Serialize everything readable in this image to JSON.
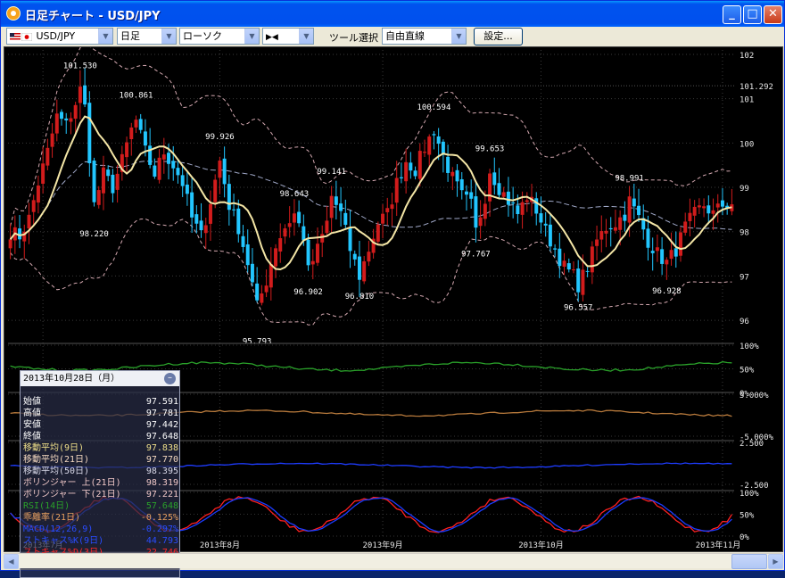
{
  "window": {
    "title": "日足チャート - USD/JPY"
  },
  "toolbar": {
    "symbol": "USD/JPY",
    "period": "日足",
    "chart_style": "ローソク",
    "marker": "▶◀",
    "tool_label": "ツール選択",
    "tool_value": "自由直線",
    "settings_label": "設定..."
  },
  "colors": {
    "up": "#d21c1c",
    "down": "#22c6ff",
    "ma9": "#f4e6a6",
    "bb": "#d4a8b0",
    "rsi": "#2aa22a",
    "deviation": "#b87a3c",
    "macd": "#1e3cff",
    "stoch_k": "#ff2020",
    "stoch_d": "#1c3cff"
  },
  "info": {
    "date": "2013年10月28日（月）",
    "rows": [
      {
        "label": "始値",
        "value": "97.591",
        "color": "#ffffff"
      },
      {
        "label": "高値",
        "value": "97.781",
        "color": "#ffffff"
      },
      {
        "label": "安値",
        "value": "97.442",
        "color": "#ffffff"
      },
      {
        "label": "終値",
        "value": "97.648",
        "color": "#ffffff"
      },
      {
        "label": "移動平均(9日)",
        "value": "97.838",
        "color": "#f0e08a"
      },
      {
        "label": "移動平均(21日)",
        "value": "97.770",
        "color": "#f4d8c0"
      },
      {
        "label": "移動平均(50日)",
        "value": "98.395",
        "color": "#d8d8e8"
      },
      {
        "label": "ボリンジャー 上(21日)",
        "value": "98.319",
        "color": "#f0c8c8"
      },
      {
        "label": "ボリンジャー 下(21日)",
        "value": "97.221",
        "color": "#f0c8c8"
      },
      {
        "label": "RSI(14日)",
        "value": "57.648",
        "color": "#2aa22a"
      },
      {
        "label": "乖離率(21日)",
        "value": "-0.125%",
        "color": "#e8a060"
      },
      {
        "label": "MACD(12,26,9)",
        "value": "-0.297%",
        "color": "#2a4cff"
      },
      {
        "label": "ストキャス%K(9日)",
        "value": "44.793",
        "color": "#2a4cff"
      },
      {
        "label": "ストキャス%D(3日)",
        "value": "22.746",
        "color": "#ff2a2a"
      },
      {
        "label": "ストキャス%SD(3日)",
        "value": "36.526",
        "color": "#2a4cff"
      }
    ]
  },
  "chart_data": {
    "type": "candlestick",
    "price_axis": {
      "ylim": [
        95.8,
        102.1
      ],
      "ticks": [
        "102",
        "101",
        "100",
        "99",
        "98",
        "97",
        "96"
      ],
      "current_label": "101.292",
      "current_value": 101.292
    },
    "x_labels": [
      "2013年7月",
      "2013年8月",
      "2013年9月",
      "2013年10月",
      "2013年11月"
    ],
    "x_label_index": [
      7,
      45,
      80,
      114,
      153
    ],
    "annotations": [
      {
        "text": "101.530",
        "index": 15,
        "value": 101.53,
        "pos": "above"
      },
      {
        "text": "100.861",
        "index": 27,
        "value": 100.861,
        "pos": "above"
      },
      {
        "text": "99.926",
        "index": 45,
        "value": 99.926,
        "pos": "above"
      },
      {
        "text": "98.220",
        "index": 18,
        "value": 98.22,
        "pos": "below"
      },
      {
        "text": "99.141",
        "index": 69,
        "value": 99.141,
        "pos": "above"
      },
      {
        "text": "98.643",
        "index": 61,
        "value": 98.643,
        "pos": "above"
      },
      {
        "text": "95.793",
        "index": 53,
        "value": 95.793,
        "pos": "below"
      },
      {
        "text": "96.902",
        "index": 64,
        "value": 96.902,
        "pos": "below"
      },
      {
        "text": "96.810",
        "index": 75,
        "value": 96.81,
        "pos": "below"
      },
      {
        "text": "100.594",
        "index": 91,
        "value": 100.594,
        "pos": "above"
      },
      {
        "text": "99.653",
        "index": 103,
        "value": 99.653,
        "pos": "above"
      },
      {
        "text": "97.767",
        "index": 100,
        "value": 97.767,
        "pos": "below"
      },
      {
        "text": "96.557",
        "index": 122,
        "value": 96.557,
        "pos": "below"
      },
      {
        "text": "98.991",
        "index": 133,
        "value": 98.991,
        "pos": "above"
      },
      {
        "text": "96.928",
        "index": 141,
        "value": 96.928,
        "pos": "below"
      }
    ],
    "anchors": [
      [
        0,
        98.0
      ],
      [
        2,
        97.9
      ],
      [
        4,
        98.3
      ],
      [
        6,
        99.1
      ],
      [
        8,
        99.8
      ],
      [
        10,
        100.6
      ],
      [
        12,
        100.4
      ],
      [
        14,
        100.9
      ],
      [
        15,
        101.2
      ],
      [
        16,
        100.8
      ],
      [
        18,
        98.6
      ],
      [
        20,
        99.3
      ],
      [
        22,
        99.0
      ],
      [
        24,
        99.6
      ],
      [
        26,
        100.3
      ],
      [
        27,
        100.5
      ],
      [
        29,
        99.8
      ],
      [
        31,
        99.3
      ],
      [
        33,
        99.8
      ],
      [
        35,
        99.5
      ],
      [
        37,
        99.1
      ],
      [
        39,
        98.3
      ],
      [
        41,
        97.9
      ],
      [
        43,
        98.7
      ],
      [
        45,
        99.6
      ],
      [
        47,
        98.6
      ],
      [
        49,
        98.1
      ],
      [
        51,
        97.3
      ],
      [
        53,
        96.3
      ],
      [
        55,
        96.9
      ],
      [
        57,
        97.7
      ],
      [
        59,
        98.1
      ],
      [
        61,
        98.4
      ],
      [
        63,
        97.9
      ],
      [
        64,
        97.1
      ],
      [
        66,
        97.6
      ],
      [
        68,
        98.2
      ],
      [
        69,
        98.8
      ],
      [
        71,
        98.4
      ],
      [
        73,
        97.6
      ],
      [
        75,
        97.0
      ],
      [
        77,
        97.6
      ],
      [
        79,
        98.2
      ],
      [
        81,
        98.4
      ],
      [
        83,
        99.1
      ],
      [
        85,
        99.6
      ],
      [
        87,
        99.4
      ],
      [
        89,
        99.9
      ],
      [
        91,
        100.3
      ],
      [
        93,
        99.7
      ],
      [
        95,
        99.2
      ],
      [
        97,
        98.8
      ],
      [
        99,
        98.6
      ],
      [
        100,
        98.0
      ],
      [
        102,
        98.8
      ],
      [
        103,
        99.4
      ],
      [
        105,
        99.0
      ],
      [
        107,
        98.7
      ],
      [
        109,
        98.4
      ],
      [
        111,
        98.8
      ],
      [
        113,
        98.5
      ],
      [
        115,
        98.0
      ],
      [
        117,
        97.6
      ],
      [
        119,
        97.2
      ],
      [
        121,
        97.0
      ],
      [
        122,
        96.8
      ],
      [
        124,
        97.2
      ],
      [
        126,
        97.8
      ],
      [
        128,
        98.1
      ],
      [
        130,
        98.2
      ],
      [
        132,
        98.4
      ],
      [
        133,
        98.7
      ],
      [
        135,
        98.3
      ],
      [
        137,
        97.8
      ],
      [
        139,
        97.5
      ],
      [
        141,
        97.3
      ],
      [
        143,
        97.6
      ],
      [
        145,
        98.1
      ],
      [
        147,
        98.4
      ],
      [
        149,
        98.6
      ],
      [
        151,
        98.4
      ],
      [
        153,
        98.6
      ],
      [
        155,
        98.65
      ]
    ],
    "candle_count": 156,
    "sub_panels": [
      {
        "name": "RSI",
        "ticks": [
          "100%",
          "50%",
          "0%"
        ]
      },
      {
        "name": "乖離率",
        "ticks": [
          "5.000%",
          "-5.000%"
        ]
      },
      {
        "name": "MACD",
        "ticks": [
          "2.500",
          "-2.500"
        ]
      },
      {
        "name": "ストキャス",
        "ticks": [
          "100%",
          "50%",
          "0%"
        ]
      }
    ]
  }
}
